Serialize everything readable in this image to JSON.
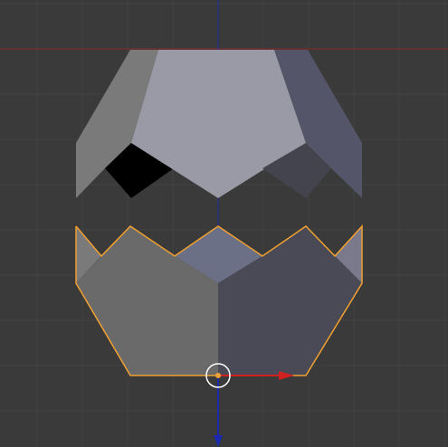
{
  "viewport": {
    "background": "#3a3a3a",
    "grid_minor_color": "#424242",
    "x_axis_color": "#8a2a2a",
    "z_axis_color": "#1a2aa8"
  },
  "mesh": {
    "selection_outline_color": "#f0a030",
    "faces": {
      "upper_center": "#9a9aa6",
      "upper_left": "#7a7a7a",
      "upper_right": "#55556a",
      "upper_inner_shadow": "#000000",
      "upper_inner_right": "#44444f",
      "lower_left": "#6a6a6a",
      "lower_right": "#4a4a56",
      "lower_mid": "#6c7086",
      "lower_right_small": "#7a7a8c"
    }
  },
  "gizmo": {
    "x_arrow_color": "#d02020",
    "z_arrow_color": "#1a2ab0",
    "pivot_color": "#f0a030",
    "ring_color": "#ffffff"
  }
}
